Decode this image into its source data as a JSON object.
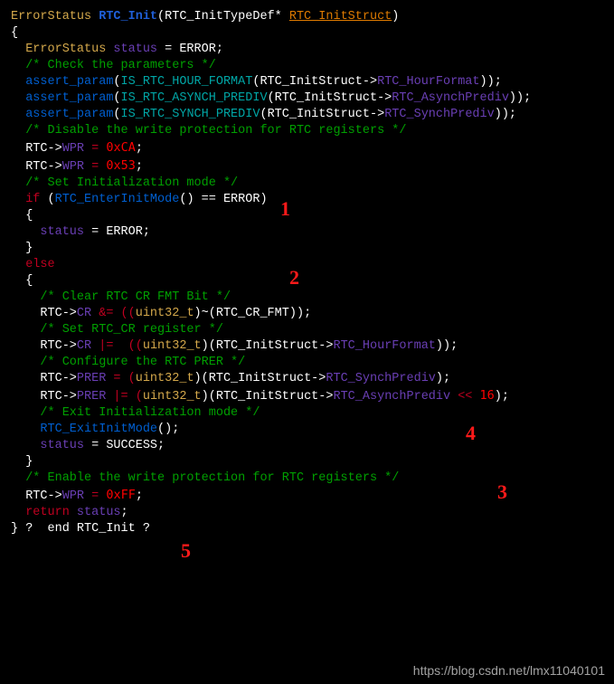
{
  "lines": {
    "l1_a": "ErrorStatus ",
    "l1_b": "RTC_Init",
    "l1_c": "(RTC_InitTypeDef* ",
    "l1_d": "RTC_InitStruct",
    "l1_e": ")",
    "l2": "{",
    "l3_a": "  ErrorStatus ",
    "l3_b": "status",
    "l3_c": " = ERROR;",
    "blank": "",
    "l4": "  /* Check the parameters */",
    "l5_a": "  assert_param",
    "l5_b": "(",
    "l5_c": "IS_RTC_HOUR_FORMAT",
    "l5_d": "(RTC_InitStruct->",
    "l5_e": "RTC_HourFormat",
    "l5_f": "));",
    "l6_a": "  assert_param",
    "l6_b": "(",
    "l6_c": "IS_RTC_ASYNCH_PREDIV",
    "l6_d": "(RTC_InitStruct->",
    "l6_e": "RTC_AsynchPrediv",
    "l6_f": "));",
    "l7_a": "  assert_param",
    "l7_b": "(",
    "l7_c": "IS_RTC_SYNCH_PREDIV",
    "l7_d": "(RTC_InitStruct->",
    "l7_e": "RTC_SynchPrediv",
    "l7_f": "));",
    "l8": "  /* Disable the write protection for RTC registers */",
    "l9_a": "  RTC->",
    "l9_b": "WPR",
    "l9_c": " = ",
    "l9_d": "0xCA",
    "l9_e": ";",
    "l10_a": "  RTC->",
    "l10_b": "WPR",
    "l10_c": " = ",
    "l10_d": "0x53",
    "l10_e": ";",
    "l11": "  /* Set Initialization mode */",
    "l12_a": "  if",
    "l12_b": " (",
    "l12_c": "RTC_EnterInitMode",
    "l12_d": "() == ERROR)",
    "l13": "  {",
    "l14_a": "    status",
    "l14_b": " = ERROR;",
    "l15": "  }",
    "l16": "  else",
    "l17": "  {",
    "l18": "    /* Clear RTC CR FMT Bit */",
    "l19_a": "    RTC->",
    "l19_b": "CR",
    "l19_c": " &= ((",
    "l19_d": "uint32_t",
    "l19_e": ")~(RTC_CR_FMT));",
    "l20": "    /* Set RTC_CR register */",
    "l21_a": "    RTC->",
    "l21_b": "CR",
    "l21_c": " |=  ((",
    "l21_d": "uint32_t",
    "l21_e": ")(RTC_InitStruct->",
    "l21_f": "RTC_HourFormat",
    "l21_g": "));",
    "l22": "    /* Configure the RTC PRER */",
    "l23_a": "    RTC->",
    "l23_b": "PRER",
    "l23_c": " = (",
    "l23_d": "uint32_t",
    "l23_e": ")(RTC_InitStruct->",
    "l23_f": "RTC_SynchPrediv",
    "l23_g": ");",
    "l24_a": "    RTC->",
    "l24_b": "PRER",
    "l24_c": " |= (",
    "l24_d": "uint32_t",
    "l24_e": ")(RTC_InitStruct->",
    "l24_f": "RTC_AsynchPrediv",
    "l24_g": " << ",
    "l24_h": "16",
    "l24_i": ");",
    "l25": "    /* Exit Initialization mode */",
    "l26_a": "    RTC_ExitInitMode",
    "l26_b": "();",
    "l27_a": "    status",
    "l27_b": " = SUCCESS;",
    "l28": "  }",
    "l29": "  /* Enable the write protection for RTC registers */",
    "l30_a": "  RTC->",
    "l30_b": "WPR",
    "l30_c": " = ",
    "l30_d": "0xFF",
    "l30_e": ";",
    "l31_a": "  return",
    "l31_b": " status",
    "l31_c": ";",
    "l32": "} ?  end RTC_Init ?"
  },
  "annotations": {
    "a1": "1",
    "a2": "2",
    "a3": "3",
    "a4": "4",
    "a5": "5"
  },
  "watermark": "https://blog.csdn.net/lmx11040101"
}
